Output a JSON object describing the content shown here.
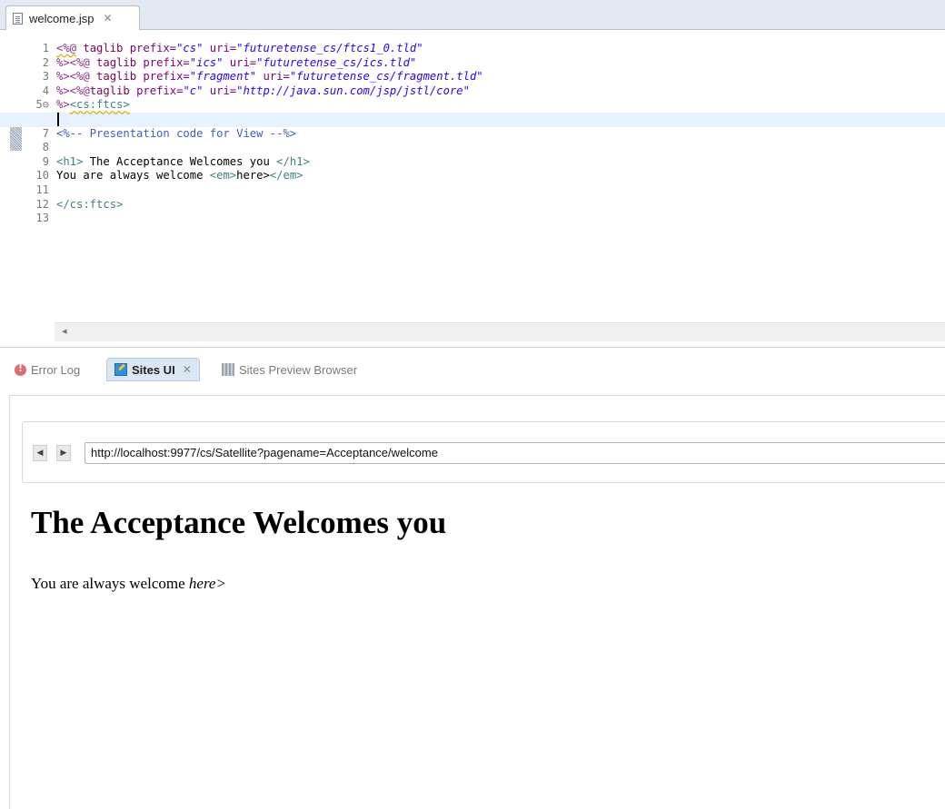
{
  "editor": {
    "tab": {
      "label": "welcome.jsp",
      "close": "✕"
    },
    "lines": [
      {
        "num": "1",
        "segs": [
          {
            "t": "<%@",
            "c": "tok-delim tok-warn"
          },
          {
            "t": " taglib ",
            "c": "tok-kw"
          },
          {
            "t": "prefix=",
            "c": "tok-attr"
          },
          {
            "t": "\"cs\"",
            "c": "tok-str"
          },
          {
            "t": " uri=",
            "c": "tok-attr"
          },
          {
            "t": "\"futuretense_cs/ftcs1_0.tld\"",
            "c": "tok-str"
          }
        ]
      },
      {
        "num": "2",
        "segs": [
          {
            "t": "%><%@",
            "c": "tok-delim"
          },
          {
            "t": " taglib ",
            "c": "tok-kw"
          },
          {
            "t": "prefix=",
            "c": "tok-attr"
          },
          {
            "t": "\"ics\"",
            "c": "tok-str"
          },
          {
            "t": " uri=",
            "c": "tok-attr"
          },
          {
            "t": "\"futuretense_cs/ics.tld\"",
            "c": "tok-str"
          }
        ]
      },
      {
        "num": "3",
        "segs": [
          {
            "t": "%><%@",
            "c": "tok-delim"
          },
          {
            "t": " taglib ",
            "c": "tok-kw"
          },
          {
            "t": "prefix=",
            "c": "tok-attr"
          },
          {
            "t": "\"fragment\"",
            "c": "tok-str"
          },
          {
            "t": " uri=",
            "c": "tok-attr"
          },
          {
            "t": "\"futuretense_cs/fragment.tld\"",
            "c": "tok-str"
          }
        ]
      },
      {
        "num": "4",
        "segs": [
          {
            "t": "%><%@",
            "c": "tok-delim"
          },
          {
            "t": "taglib ",
            "c": "tok-kw"
          },
          {
            "t": "prefix=",
            "c": "tok-attr"
          },
          {
            "t": "\"c\"",
            "c": "tok-str"
          },
          {
            "t": " uri=",
            "c": "tok-attr"
          },
          {
            "t": "\"http://java.sun.com/jsp/jstl/core\"",
            "c": "tok-str"
          }
        ]
      },
      {
        "num": "5⊖",
        "segs": [
          {
            "t": "%>",
            "c": "tok-delim"
          },
          {
            "t": "<cs:ftcs>",
            "c": "tok-tag tok-warn"
          }
        ]
      },
      {
        "num": "6",
        "segs": [],
        "current": true
      },
      {
        "num": "7",
        "segs": [
          {
            "t": "<%-- Presentation code for View --%>",
            "c": "tok-comment"
          }
        ]
      },
      {
        "num": "8",
        "segs": []
      },
      {
        "num": "9",
        "segs": [
          {
            "t": "<h1>",
            "c": "tok-tag"
          },
          {
            "t": " The Acceptance Welcomes you ",
            "c": ""
          },
          {
            "t": "</h1>",
            "c": "tok-tag"
          }
        ]
      },
      {
        "num": "10",
        "segs": [
          {
            "t": "You are always welcome ",
            "c": ""
          },
          {
            "t": "<em>",
            "c": "tok-tag"
          },
          {
            "t": "here>",
            "c": ""
          },
          {
            "t": "</em>",
            "c": "tok-tag"
          }
        ]
      },
      {
        "num": "11",
        "segs": []
      },
      {
        "num": "12",
        "segs": [
          {
            "t": "</cs:ftcs>",
            "c": "tok-tag"
          }
        ]
      },
      {
        "num": "13",
        "segs": []
      }
    ],
    "hscroll_arrow": "◂"
  },
  "views": {
    "tabs": [
      {
        "label": "Error Log",
        "icon": "error-log-icon"
      },
      {
        "label": "Sites UI",
        "icon": "sites-ui-icon",
        "close": "✕",
        "active": true
      },
      {
        "label": "Sites Preview Browser",
        "icon": "preview-browser-icon"
      }
    ]
  },
  "browser": {
    "back": "◀",
    "forward": "▶",
    "url": "http://localhost:9977/cs/Satellite?pagename=Acceptance/welcome",
    "heading": "The Acceptance Welcomes you",
    "paragraph_text": "You are always welcome ",
    "paragraph_em": "here>"
  }
}
